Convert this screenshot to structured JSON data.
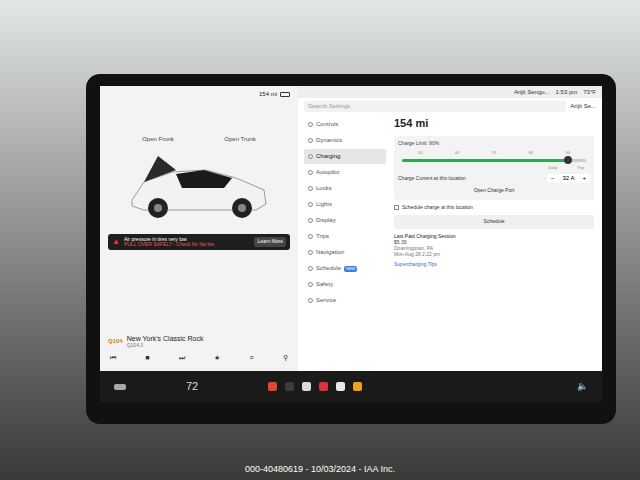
{
  "left_status": {
    "range": "154 mi"
  },
  "car": {
    "frunk": "Open Frunk",
    "trunk": "Open Trunk"
  },
  "alert": {
    "title": "Air pressure in tires very low",
    "subtitle": "PULL OVER SAFELY - Check for flat tire",
    "button": "Learn More"
  },
  "media": {
    "logo": "Q104",
    "station": "New York's Classic Rock",
    "frequency": "Q104.3"
  },
  "top_bar": {
    "user": "Arijit Sengu...",
    "time": "1:53 pm",
    "temp": "73°F"
  },
  "settings": {
    "search_placeholder": "Search Settings",
    "profile": "Arijit Se...",
    "menu": [
      {
        "label": "Controls",
        "selected": false,
        "badge": ""
      },
      {
        "label": "Dynamics",
        "selected": false,
        "badge": ""
      },
      {
        "label": "Charging",
        "selected": true,
        "badge": ""
      },
      {
        "label": "Autopilot",
        "selected": false,
        "badge": ""
      },
      {
        "label": "Locks",
        "selected": false,
        "badge": ""
      },
      {
        "label": "Lights",
        "selected": false,
        "badge": ""
      },
      {
        "label": "Display",
        "selected": false,
        "badge": ""
      },
      {
        "label": "Trips",
        "selected": false,
        "badge": ""
      },
      {
        "label": "Navigation",
        "selected": false,
        "badge": ""
      },
      {
        "label": "Schedule",
        "selected": false,
        "badge": "NEW"
      },
      {
        "label": "Safety",
        "selected": false,
        "badge": ""
      },
      {
        "label": "Service",
        "selected": false,
        "badge": ""
      }
    ]
  },
  "charging": {
    "range": "154 mi",
    "charge_limit": "Charge Limit: 90%",
    "level": 0.9,
    "ticks": [
      "50",
      "60",
      "70",
      "80",
      "90"
    ],
    "daily": "Daily",
    "trip": "Trip",
    "current_label": "Charge Current at this location",
    "minus": "−",
    "current": "32 A",
    "plus": "+",
    "open_port": "Open Charge Port",
    "schedule_label": "Schedule charge at this location",
    "schedule_button": "Schedule",
    "last_title": "Last Paid Charging Session",
    "last_amount": "$5.39",
    "last_place": "Downingtown, PA",
    "last_date": "Mon Aug 26 2:22 pm",
    "tips": "Supercharging Tips"
  },
  "bottom_bar": {
    "temp": "72",
    "apps": [
      {
        "color": "#e2462f"
      },
      {
        "color": "#3b3b3b"
      },
      {
        "color": "#d9d9d9"
      },
      {
        "color": "#d8343a"
      },
      {
        "color": "#e8e8e8"
      },
      {
        "color": "#f0a020"
      }
    ]
  },
  "watermark": "000-40480619 - 10/03/2024 - IAA Inc."
}
